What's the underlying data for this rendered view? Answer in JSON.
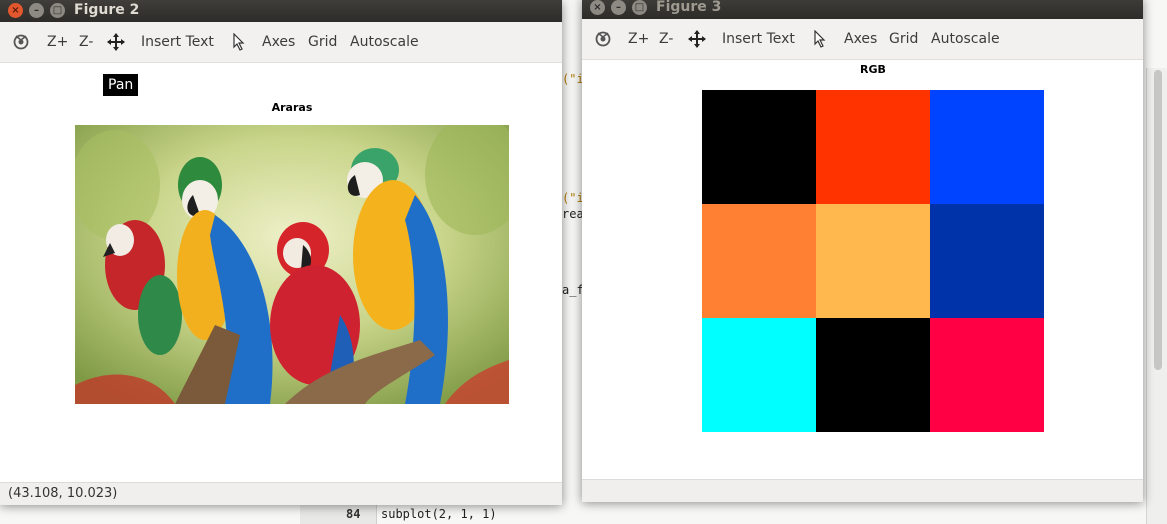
{
  "editor": {
    "code_lines": [
      {
        "text": "(\"i"
      },
      {
        "text": "(\"i"
      },
      {
        "text": "rea"
      },
      {
        "text": "a_f"
      }
    ],
    "line_number": "84",
    "last_line": {
      "fn": "subplot",
      "args": "(2, 1, 1)"
    }
  },
  "fig2": {
    "title": "Figure 2",
    "toolbar": {
      "home_icon": "home-icon",
      "zoom_in": "Z+",
      "zoom_out": "Z-",
      "pan_icon": "pan-icon",
      "insert_text": "Insert Text",
      "select_icon": "arrow-pointer-icon",
      "axes": "Axes",
      "grid": "Grid",
      "autoscale": "Autoscale"
    },
    "tooltip": "Pan",
    "plot_title": "Araras",
    "status": "(43.108, 10.023)"
  },
  "fig3": {
    "title": "Figure 3",
    "toolbar": {
      "home_icon": "home-icon",
      "zoom_in": "Z+",
      "zoom_out": "Z-",
      "pan_icon": "pan-icon",
      "insert_text": "Insert Text",
      "select_icon": "arrow-pointer-icon",
      "axes": "Axes",
      "grid": "Grid",
      "autoscale": "Autoscale"
    },
    "plot_title": "RGB",
    "grid_colors": [
      [
        "#000000",
        "#ff3300",
        "#0044ff"
      ],
      [
        "#ff7f33",
        "#ffb84d",
        "#0033aa"
      ],
      [
        "#00ffff",
        "#000000",
        "#ff0044"
      ]
    ]
  }
}
